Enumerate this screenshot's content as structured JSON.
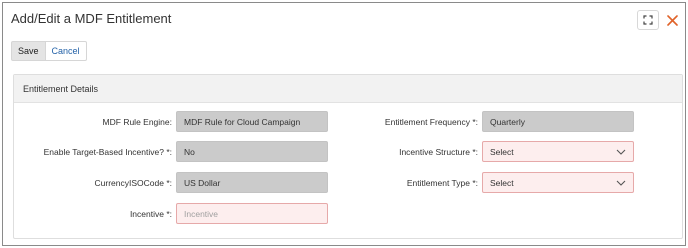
{
  "dialog": {
    "title": "Add/Edit a MDF Entitlement"
  },
  "toolbar": {
    "save_label": "Save",
    "cancel_label": "Cancel"
  },
  "panel": {
    "title": "Entitlement Details"
  },
  "left_fields": [
    {
      "label": "MDF Rule Engine:",
      "value": "MDF Rule for Cloud Campaign"
    },
    {
      "label": "Enable Target-Based Incentive? *:",
      "value": "No"
    },
    {
      "label": "CurrencyISOCode *:",
      "value": "US Dollar"
    },
    {
      "label": "Incentive *:",
      "placeholder": "Incentive"
    }
  ],
  "right_fields": [
    {
      "label": "Entitlement Frequency *:",
      "value": "Quarterly"
    },
    {
      "label": "Incentive Structure *:",
      "value": "Select"
    },
    {
      "label": "Entitlement Type *:",
      "value": "Select"
    }
  ],
  "colors": {
    "required_bg": "#fdeeee",
    "required_border": "#e6a9a9",
    "readonly_bg": "#cbcbcb",
    "close_icon": "#e0632a",
    "link": "#2563a8"
  },
  "icons": {
    "expand": "expand-icon",
    "close": "close-icon",
    "dropdown": "chevron-down-icon"
  }
}
